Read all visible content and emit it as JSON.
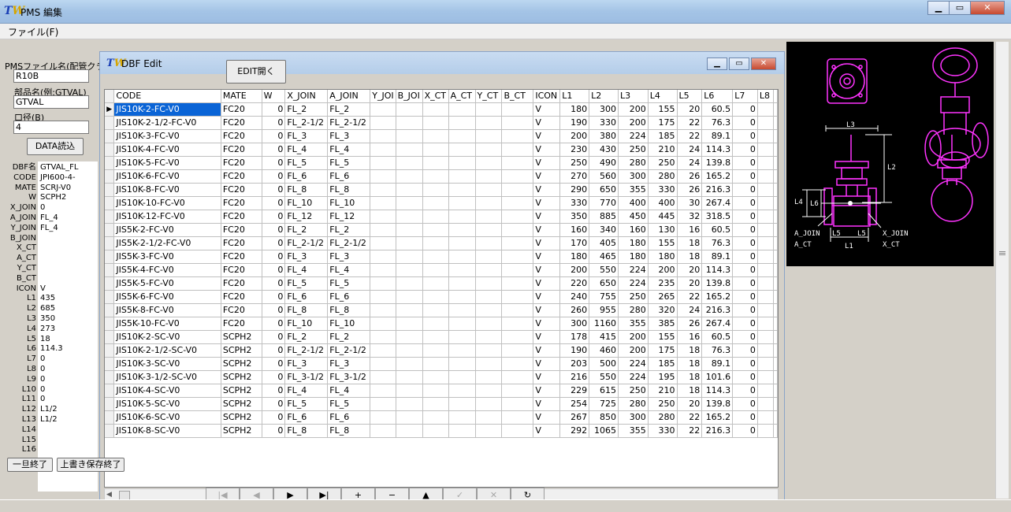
{
  "window": {
    "title": "PMS 編集",
    "icon_glyph": "TW",
    "buttons": [
      "minimize",
      "maximize",
      "close"
    ]
  },
  "menu": {
    "file_label": "ファイル(F)"
  },
  "left_panel": {
    "pms_file_label": "PMSファイル名(配管クラ",
    "pms_file_value": "R10B",
    "part_name_label": "部品名(例:GTVAL)",
    "part_name_value": "GTVAL",
    "diameter_label": "口径(B)",
    "diameter_value": "4",
    "data_load_label": "DATA読込",
    "fields": [
      {
        "name": "DBF名",
        "value": "GTVAL_FL"
      },
      {
        "name": "CODE",
        "value": "JPI600-4-"
      },
      {
        "name": "MATE",
        "value": "SCRJ-V0"
      },
      {
        "name": "W",
        "value": "SCPH2"
      },
      {
        "name": "X_JOIN",
        "value": "0"
      },
      {
        "name": "A_JOIN",
        "value": "FL_4"
      },
      {
        "name": "Y_JOIN",
        "value": "FL_4"
      },
      {
        "name": "B_JOIN",
        "value": ""
      },
      {
        "name": "X_CT",
        "value": ""
      },
      {
        "name": "A_CT",
        "value": ""
      },
      {
        "name": "Y_CT",
        "value": ""
      },
      {
        "name": "B_CT",
        "value": ""
      },
      {
        "name": "ICON",
        "value": "V"
      },
      {
        "name": "L1",
        "value": "435"
      },
      {
        "name": "L2",
        "value": "685"
      },
      {
        "name": "L3",
        "value": "350"
      },
      {
        "name": "L4",
        "value": "273"
      },
      {
        "name": "L5",
        "value": "18"
      },
      {
        "name": "L6",
        "value": "114.3"
      },
      {
        "name": "L7",
        "value": "0"
      },
      {
        "name": "L8",
        "value": "0"
      },
      {
        "name": "L9",
        "value": "0"
      },
      {
        "name": "L10",
        "value": "0"
      },
      {
        "name": "L11",
        "value": "0"
      },
      {
        "name": "L12",
        "value": "L1/2"
      },
      {
        "name": "L13",
        "value": "L1/2"
      },
      {
        "name": "L14",
        "value": ""
      },
      {
        "name": "L15",
        "value": ""
      },
      {
        "name": "L16",
        "value": ""
      }
    ],
    "temp_exit_label": "一旦終了",
    "save_exit_label": "上書き保存終了"
  },
  "dbf_window": {
    "title": "DBF Edit",
    "edit_open_label": "EDIT開く",
    "columns": [
      "CODE",
      "MATE",
      "W",
      "X_JOIN",
      "A_JOIN",
      "Y_JOI",
      "B_JOI",
      "X_CT",
      "A_CT",
      "Y_CT",
      "B_CT",
      "ICON",
      "L1",
      "L2",
      "L3",
      "L4",
      "L5",
      "L6",
      "L7",
      "L8"
    ],
    "rows": [
      [
        "JIS10K-2-FC-V0",
        "FC20",
        "0",
        "FL_2",
        "FL_2",
        "",
        "",
        "",
        "",
        "",
        "",
        "V",
        "180",
        "300",
        "200",
        "155",
        "20",
        "60.5",
        "0",
        ""
      ],
      [
        "JIS10K-2-1/2-FC-V0",
        "FC20",
        "0",
        "FL_2-1/2",
        "FL_2-1/2",
        "",
        "",
        "",
        "",
        "",
        "",
        "V",
        "190",
        "330",
        "200",
        "175",
        "22",
        "76.3",
        "0",
        ""
      ],
      [
        "JIS10K-3-FC-V0",
        "FC20",
        "0",
        "FL_3",
        "FL_3",
        "",
        "",
        "",
        "",
        "",
        "",
        "V",
        "200",
        "380",
        "224",
        "185",
        "22",
        "89.1",
        "0",
        ""
      ],
      [
        "JIS10K-4-FC-V0",
        "FC20",
        "0",
        "FL_4",
        "FL_4",
        "",
        "",
        "",
        "",
        "",
        "",
        "V",
        "230",
        "430",
        "250",
        "210",
        "24",
        "114.3",
        "0",
        ""
      ],
      [
        "JIS10K-5-FC-V0",
        "FC20",
        "0",
        "FL_5",
        "FL_5",
        "",
        "",
        "",
        "",
        "",
        "",
        "V",
        "250",
        "490",
        "280",
        "250",
        "24",
        "139.8",
        "0",
        ""
      ],
      [
        "JIS10K-6-FC-V0",
        "FC20",
        "0",
        "FL_6",
        "FL_6",
        "",
        "",
        "",
        "",
        "",
        "",
        "V",
        "270",
        "560",
        "300",
        "280",
        "26",
        "165.2",
        "0",
        ""
      ],
      [
        "JIS10K-8-FC-V0",
        "FC20",
        "0",
        "FL_8",
        "FL_8",
        "",
        "",
        "",
        "",
        "",
        "",
        "V",
        "290",
        "650",
        "355",
        "330",
        "26",
        "216.3",
        "0",
        ""
      ],
      [
        "JIS10K-10-FC-V0",
        "FC20",
        "0",
        "FL_10",
        "FL_10",
        "",
        "",
        "",
        "",
        "",
        "",
        "V",
        "330",
        "770",
        "400",
        "400",
        "30",
        "267.4",
        "0",
        ""
      ],
      [
        "JIS10K-12-FC-V0",
        "FC20",
        "0",
        "FL_12",
        "FL_12",
        "",
        "",
        "",
        "",
        "",
        "",
        "V",
        "350",
        "885",
        "450",
        "445",
        "32",
        "318.5",
        "0",
        ""
      ],
      [
        "JIS5K-2-FC-V0",
        "FC20",
        "0",
        "FL_2",
        "FL_2",
        "",
        "",
        "",
        "",
        "",
        "",
        "V",
        "160",
        "340",
        "160",
        "130",
        "16",
        "60.5",
        "0",
        ""
      ],
      [
        "JIS5K-2-1/2-FC-V0",
        "FC20",
        "0",
        "FL_2-1/2",
        "FL_2-1/2",
        "",
        "",
        "",
        "",
        "",
        "",
        "V",
        "170",
        "405",
        "180",
        "155",
        "18",
        "76.3",
        "0",
        ""
      ],
      [
        "JIS5K-3-FC-V0",
        "FC20",
        "0",
        "FL_3",
        "FL_3",
        "",
        "",
        "",
        "",
        "",
        "",
        "V",
        "180",
        "465",
        "180",
        "180",
        "18",
        "89.1",
        "0",
        ""
      ],
      [
        "JIS5K-4-FC-V0",
        "FC20",
        "0",
        "FL_4",
        "FL_4",
        "",
        "",
        "",
        "",
        "",
        "",
        "V",
        "200",
        "550",
        "224",
        "200",
        "20",
        "114.3",
        "0",
        ""
      ],
      [
        "JIS5K-5-FC-V0",
        "FC20",
        "0",
        "FL_5",
        "FL_5",
        "",
        "",
        "",
        "",
        "",
        "",
        "V",
        "220",
        "650",
        "224",
        "235",
        "20",
        "139.8",
        "0",
        ""
      ],
      [
        "JIS5K-6-FC-V0",
        "FC20",
        "0",
        "FL_6",
        "FL_6",
        "",
        "",
        "",
        "",
        "",
        "",
        "V",
        "240",
        "755",
        "250",
        "265",
        "22",
        "165.2",
        "0",
        ""
      ],
      [
        "JIS5K-8-FC-V0",
        "FC20",
        "0",
        "FL_8",
        "FL_8",
        "",
        "",
        "",
        "",
        "",
        "",
        "V",
        "260",
        "955",
        "280",
        "320",
        "24",
        "216.3",
        "0",
        ""
      ],
      [
        "JIS5K-10-FC-V0",
        "FC20",
        "0",
        "FL_10",
        "FL_10",
        "",
        "",
        "",
        "",
        "",
        "",
        "V",
        "300",
        "1160",
        "355",
        "385",
        "26",
        "267.4",
        "0",
        ""
      ],
      [
        "JIS10K-2-SC-V0",
        "SCPH2",
        "0",
        "FL_2",
        "FL_2",
        "",
        "",
        "",
        "",
        "",
        "",
        "V",
        "178",
        "415",
        "200",
        "155",
        "16",
        "60.5",
        "0",
        ""
      ],
      [
        "JIS10K-2-1/2-SC-V0",
        "SCPH2",
        "0",
        "FL_2-1/2",
        "FL_2-1/2",
        "",
        "",
        "",
        "",
        "",
        "",
        "V",
        "190",
        "460",
        "200",
        "175",
        "18",
        "76.3",
        "0",
        ""
      ],
      [
        "JIS10K-3-SC-V0",
        "SCPH2",
        "0",
        "FL_3",
        "FL_3",
        "",
        "",
        "",
        "",
        "",
        "",
        "V",
        "203",
        "500",
        "224",
        "185",
        "18",
        "89.1",
        "0",
        ""
      ],
      [
        "JIS10K-3-1/2-SC-V0",
        "SCPH2",
        "0",
        "FL_3-1/2",
        "FL_3-1/2",
        "",
        "",
        "",
        "",
        "",
        "",
        "V",
        "216",
        "550",
        "224",
        "195",
        "18",
        "101.6",
        "0",
        ""
      ],
      [
        "JIS10K-4-SC-V0",
        "SCPH2",
        "0",
        "FL_4",
        "FL_4",
        "",
        "",
        "",
        "",
        "",
        "",
        "V",
        "229",
        "615",
        "250",
        "210",
        "18",
        "114.3",
        "0",
        ""
      ],
      [
        "JIS10K-5-SC-V0",
        "SCPH2",
        "0",
        "FL_5",
        "FL_5",
        "",
        "",
        "",
        "",
        "",
        "",
        "V",
        "254",
        "725",
        "280",
        "250",
        "20",
        "139.8",
        "0",
        ""
      ],
      [
        "JIS10K-6-SC-V0",
        "SCPH2",
        "0",
        "FL_6",
        "FL_6",
        "",
        "",
        "",
        "",
        "",
        "",
        "V",
        "267",
        "850",
        "300",
        "280",
        "22",
        "165.2",
        "0",
        ""
      ],
      [
        "JIS10K-8-SC-V0",
        "SCPH2",
        "0",
        "FL_8",
        "FL_8",
        "",
        "",
        "",
        "",
        "",
        "",
        "V",
        "292",
        "1065",
        "355",
        "330",
        "22",
        "216.3",
        "0",
        ""
      ]
    ],
    "selected_row": 0,
    "navigator": [
      {
        "name": "first",
        "glyph": "|◀",
        "enabled": false
      },
      {
        "name": "prior",
        "glyph": "◀",
        "enabled": false
      },
      {
        "name": "next",
        "glyph": "▶",
        "enabled": true
      },
      {
        "name": "last",
        "glyph": "▶|",
        "enabled": true
      },
      {
        "name": "insert",
        "glyph": "+",
        "enabled": true
      },
      {
        "name": "delete",
        "glyph": "−",
        "enabled": true
      },
      {
        "name": "edit",
        "glyph": "▲",
        "enabled": true
      },
      {
        "name": "post",
        "glyph": "✓",
        "enabled": false
      },
      {
        "name": "cancel",
        "glyph": "✕",
        "enabled": false
      },
      {
        "name": "refresh",
        "glyph": "↻",
        "enabled": true
      }
    ]
  },
  "preview": {
    "labels": [
      "L3",
      "L2",
      "L4",
      "L6",
      "A_JOIN",
      "A_CT",
      "L5",
      "L5",
      "L1",
      "X_JOIN",
      "X_CT"
    ],
    "line_color": "#ff33ff"
  }
}
